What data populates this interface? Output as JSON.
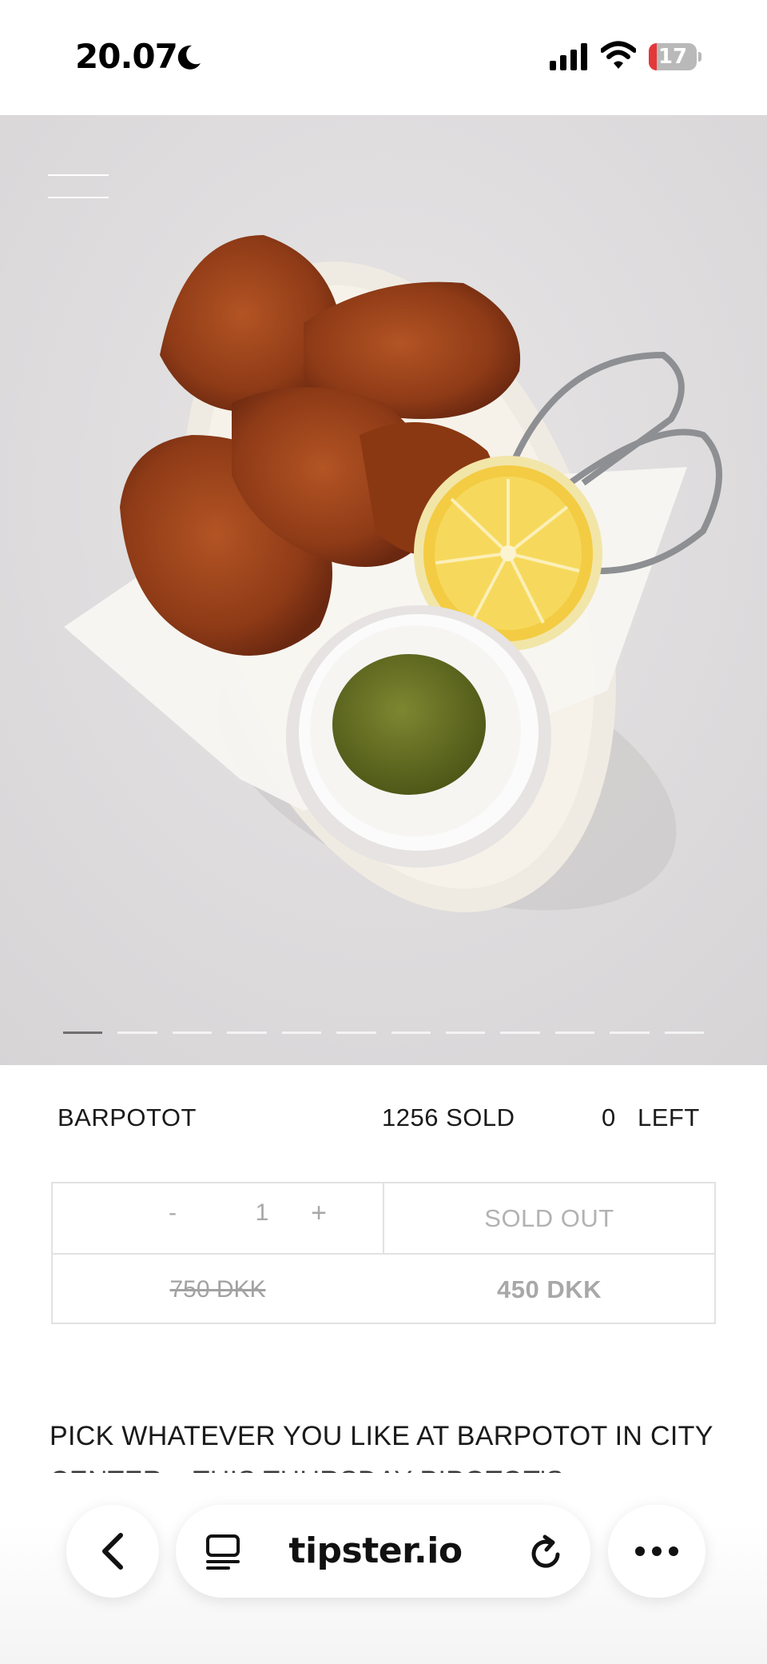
{
  "status_bar": {
    "time": "20.07",
    "battery_level": "17",
    "moon_icon": "moon-icon",
    "signal_icon": "cellular-signal-icon",
    "wifi_icon": "wifi-icon"
  },
  "hero": {
    "image_alt": "Fried chicken pieces on an oval plate with a lemon half and a dip with green pesto",
    "menu_icon": "hamburger-menu-icon",
    "carousel": {
      "total": 12,
      "active_index": 0
    }
  },
  "deal": {
    "venue": "BARPOTOT",
    "sold": "1256 SOLD",
    "left_count": "0",
    "left_label": "LEFT"
  },
  "purchase": {
    "minus": "-",
    "quantity": "1",
    "plus": "+",
    "status_button": "SOLD OUT",
    "old_price": "750 DKK",
    "new_price": "450 DKK"
  },
  "description": {
    "text": "PICK WHATEVER YOU LIKE AT BARPOTOT IN CITY CENTER – THIS THURSDAY PIPOTOT'S"
  },
  "browser": {
    "url": "tipster.io",
    "back_icon": "chevron-left-icon",
    "reader_icon": "reader-mode-icon",
    "reload_icon": "reload-icon",
    "more_icon": "more-dots-icon"
  },
  "colors": {
    "battery_low": "#e5383b",
    "text_primary": "#1a1a1a",
    "muted": "#a8a8a8",
    "border": "#e2e2e2"
  }
}
